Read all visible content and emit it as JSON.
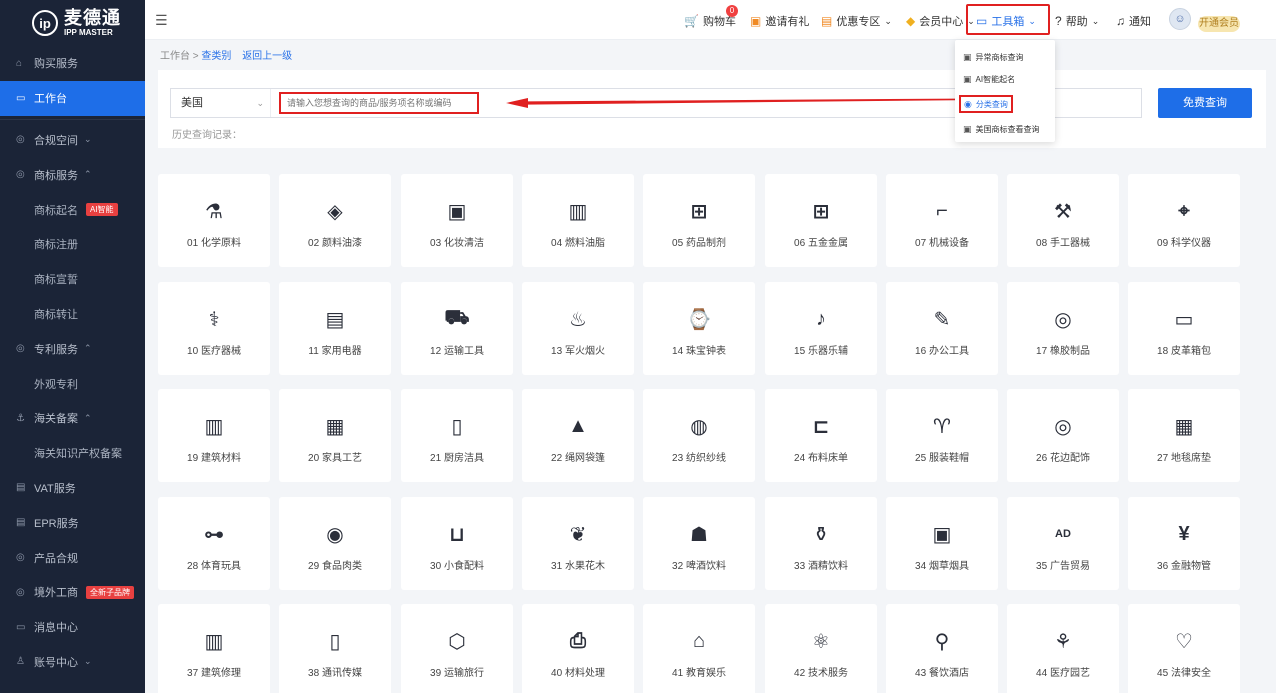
{
  "brand": {
    "mark": "ip",
    "name_cn": "麦德通",
    "name_en": "IPP MASTER"
  },
  "sidebar": {
    "items": [
      {
        "label": "购买服务",
        "icon": "bag-icon",
        "glyph": "⌂",
        "type": "top"
      },
      {
        "label": "工作台",
        "icon": "monitor-icon",
        "glyph": "▭",
        "type": "active"
      },
      {
        "label": "合规空间",
        "icon": "shield-icon",
        "glyph": "◎",
        "type": "group",
        "chev": "⌄"
      },
      {
        "label": "商标服务",
        "icon": "trademark-icon",
        "glyph": "◎",
        "type": "group",
        "chev": "⌃"
      },
      {
        "label": "商标起名",
        "type": "sub",
        "badge": "AI智能"
      },
      {
        "label": "商标注册",
        "type": "sub"
      },
      {
        "label": "商标宣誓",
        "type": "sub"
      },
      {
        "label": "商标转让",
        "type": "sub"
      },
      {
        "label": "专利服务",
        "icon": "patent-icon",
        "glyph": "◎",
        "type": "group",
        "chev": "⌃"
      },
      {
        "label": "外观专利",
        "type": "sub"
      },
      {
        "label": "海关备案",
        "icon": "anchor-icon",
        "glyph": "⚓",
        "type": "group",
        "chev": "⌃"
      },
      {
        "label": "海关知识产权备案",
        "type": "sub"
      },
      {
        "label": "VAT服务",
        "icon": "vat-icon",
        "glyph": "▤",
        "type": "top"
      },
      {
        "label": "EPR服务",
        "icon": "epr-icon",
        "glyph": "▤",
        "type": "top"
      },
      {
        "label": "产品合规",
        "icon": "compliance-icon",
        "glyph": "◎",
        "type": "top"
      },
      {
        "label": "境外工商",
        "icon": "globe-icon",
        "glyph": "◎",
        "type": "top",
        "badge": "全新子品牌"
      },
      {
        "label": "消息中心",
        "icon": "message-icon",
        "glyph": "▭",
        "type": "top"
      },
      {
        "label": "账号中心",
        "icon": "user-icon",
        "glyph": "♙",
        "type": "group",
        "chev": "⌄"
      }
    ]
  },
  "topbar": {
    "cart": {
      "label": "购物车",
      "count": "0"
    },
    "invite": "邀请有礼",
    "coupon": "优惠专区",
    "member": "会员中心",
    "toolbox": "工具箱",
    "help": "帮助",
    "notify": "通知",
    "vip": "开通会员",
    "fold_glyph": "☰"
  },
  "breadcrumb": {
    "root": "工作台",
    "current": "查类别",
    "back": "返回上一级"
  },
  "search": {
    "country": "美国",
    "placeholder": "请输入您想查询的商品/服务项名称或编码",
    "button": "免费查询",
    "history_label": "历史查询记录："
  },
  "toolbox_menu": [
    {
      "label": "异常商标查询",
      "icon": "abnormal-search-icon",
      "glyph": "▣"
    },
    {
      "label": "AI智能起名",
      "icon": "ai-icon",
      "glyph": "▣"
    },
    {
      "label": "分类查询",
      "icon": "category-search-icon",
      "glyph": "◉",
      "selected": true
    },
    {
      "label": "美国商标查看查询",
      "icon": "us-trademark-icon",
      "glyph": "▣"
    }
  ],
  "categories": [
    {
      "label": "01 化学原料",
      "icon": "flask-icon",
      "glyph": "⚗"
    },
    {
      "label": "02 颜料油漆",
      "icon": "paint-bucket-icon",
      "glyph": "◈"
    },
    {
      "label": "03 化妆清洁",
      "icon": "cosmetics-icon",
      "glyph": "▣"
    },
    {
      "label": "04 燃料油脂",
      "icon": "fuel-icon",
      "glyph": "▥"
    },
    {
      "label": "05 药品制剂",
      "icon": "medicine-box-icon",
      "glyph": "⊞"
    },
    {
      "label": "06 五金金属",
      "icon": "metal-blocks-icon",
      "glyph": "⊞"
    },
    {
      "label": "07 机械设备",
      "icon": "drill-icon",
      "glyph": "⌐"
    },
    {
      "label": "08 手工器械",
      "icon": "tools-icon",
      "glyph": "⚒"
    },
    {
      "label": "09 科学仪器",
      "icon": "microscope-icon",
      "glyph": "⌖"
    },
    {
      "label": "10 医疗器械",
      "icon": "stethoscope-icon",
      "glyph": "⚕"
    },
    {
      "label": "11 家用电器",
      "icon": "air-conditioner-icon",
      "glyph": "▤"
    },
    {
      "label": "12 运输工具",
      "icon": "truck-icon",
      "glyph": "⛟"
    },
    {
      "label": "13 军火烟火",
      "icon": "fire-icon",
      "glyph": "♨"
    },
    {
      "label": "14 珠宝钟表",
      "icon": "watch-icon",
      "glyph": "⌚"
    },
    {
      "label": "15 乐器乐辅",
      "icon": "guitar-icon",
      "glyph": "♪"
    },
    {
      "label": "16 办公工具",
      "icon": "office-icon",
      "glyph": "✎"
    },
    {
      "label": "17 橡胶制品",
      "icon": "tire-icon",
      "glyph": "◎"
    },
    {
      "label": "18 皮革箱包",
      "icon": "wallet-icon",
      "glyph": "▭"
    },
    {
      "label": "19 建筑材料",
      "icon": "building-material-icon",
      "glyph": "▥"
    },
    {
      "label": "20 家具工艺",
      "icon": "furniture-icon",
      "glyph": "▦"
    },
    {
      "label": "21 厨房洁具",
      "icon": "spray-bottle-icon",
      "glyph": "▯"
    },
    {
      "label": "22 绳网袋篷",
      "icon": "tent-icon",
      "glyph": "▲"
    },
    {
      "label": "23 纺织纱线",
      "icon": "yarn-icon",
      "glyph": "◍"
    },
    {
      "label": "24 布料床单",
      "icon": "fabric-icon",
      "glyph": "⊏"
    },
    {
      "label": "25 服装鞋帽",
      "icon": "tshirt-icon",
      "glyph": "♈"
    },
    {
      "label": "26 花边配饰",
      "icon": "button-icon",
      "glyph": "◎"
    },
    {
      "label": "27 地毯席垫",
      "icon": "carpet-icon",
      "glyph": "▦"
    },
    {
      "label": "28 体育玩具",
      "icon": "dumbbell-icon",
      "glyph": "⊶"
    },
    {
      "label": "29 食品肉类",
      "icon": "meat-icon",
      "glyph": "◉"
    },
    {
      "label": "30 小食配料",
      "icon": "noodles-icon",
      "glyph": "⊔"
    },
    {
      "label": "31 水果花木",
      "icon": "plant-icon",
      "glyph": "❦"
    },
    {
      "label": "32 啤酒饮料",
      "icon": "chef-hat-icon",
      "glyph": "☗"
    },
    {
      "label": "33 酒精饮料",
      "icon": "bottles-icon",
      "glyph": "⚱"
    },
    {
      "label": "34 烟草烟具",
      "icon": "tobacco-icon",
      "glyph": "▣"
    },
    {
      "label": "35 广告贸易",
      "icon": "ad-icon",
      "glyph": "AD"
    },
    {
      "label": "36 金融物管",
      "icon": "finance-icon",
      "glyph": "¥"
    },
    {
      "label": "37 建筑修理",
      "icon": "construction-icon",
      "glyph": "▥"
    },
    {
      "label": "38 通讯传媒",
      "icon": "phone-icon",
      "glyph": "▯"
    },
    {
      "label": "39 运输旅行",
      "icon": "package-icon",
      "glyph": "⬡"
    },
    {
      "label": "40 材料处理",
      "icon": "printer-icon",
      "glyph": "⎙"
    },
    {
      "label": "41 教育娱乐",
      "icon": "graduation-cap-icon",
      "glyph": "⌂"
    },
    {
      "label": "42 技术服务",
      "icon": "atom-icon",
      "glyph": "⚛"
    },
    {
      "label": "43 餐饮酒店",
      "icon": "dining-icon",
      "glyph": "⚲"
    },
    {
      "label": "44 医疗园艺",
      "icon": "potted-plant-icon",
      "glyph": "⚘"
    },
    {
      "label": "45 法律安全",
      "icon": "care-hands-icon",
      "glyph": "♡"
    }
  ],
  "colors": {
    "sidebar_bg": "#1b2437",
    "accent": "#1e6ee8",
    "highlight": "#e02020",
    "page_bg": "#f3f5f8"
  }
}
